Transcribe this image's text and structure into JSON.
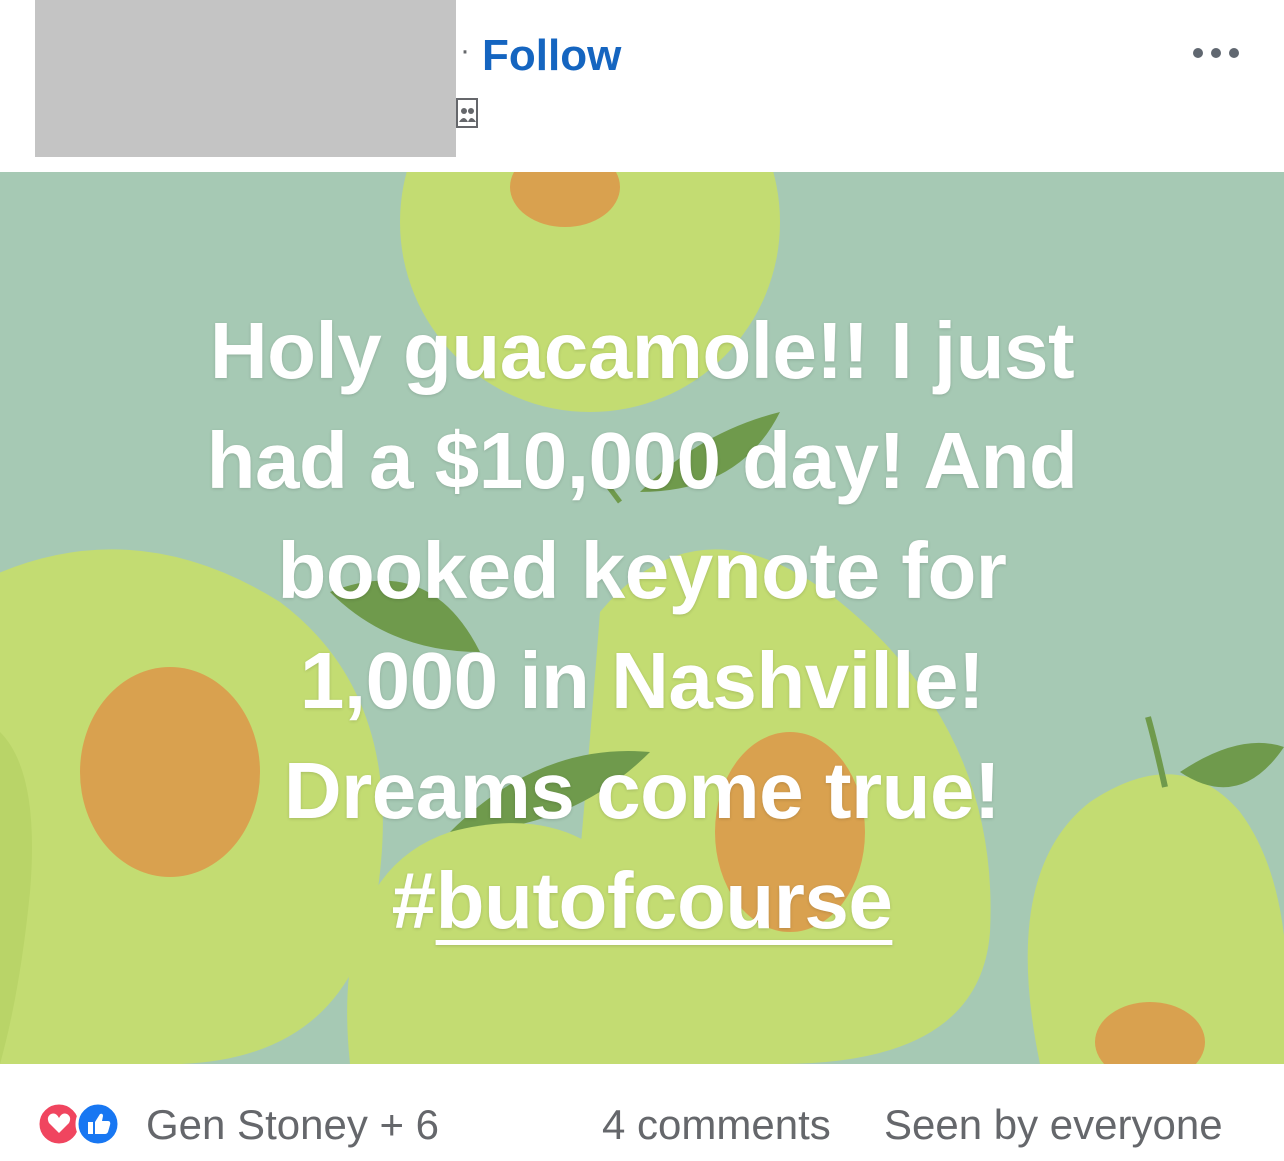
{
  "header": {
    "separator": "·",
    "follow_label": "Follow",
    "more_label": "•••"
  },
  "post": {
    "text_lines": [
      "Holy guacamole!! I just",
      "had a $10,000 day!  And",
      "booked keynote for",
      "1,000 in Nashville!",
      "Dreams come true!"
    ],
    "hashtag_prefix": "#",
    "hashtag_word": "butofcourse",
    "background_color": "#a6c9b4",
    "avocado_color": "#c3dc72",
    "pit_color": "#d9a14f",
    "leaf_color": "#6f9a4c"
  },
  "footer": {
    "reactors": "Gen Stoney + 6",
    "comments": "4 comments",
    "seen": "Seen by everyone",
    "love_color": "#f0455f",
    "like_color": "#1877f2"
  }
}
